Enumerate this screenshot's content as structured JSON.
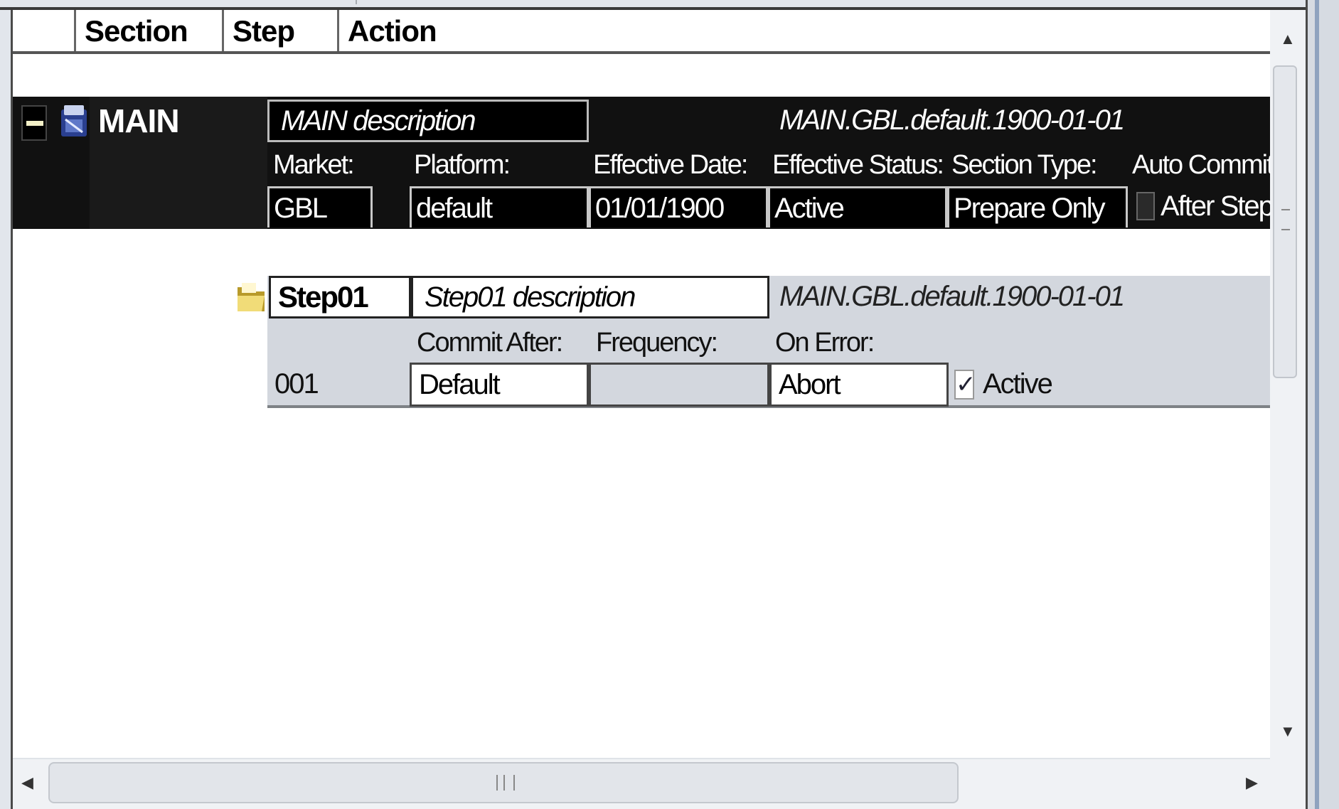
{
  "columns": {
    "section": "Section",
    "step": "Step",
    "action": "Action"
  },
  "section": {
    "name": "MAIN",
    "description": "MAIN description",
    "summary": "MAIN.GBL.default.1900-01-01",
    "labels": {
      "market": "Market:",
      "platform": "Platform:",
      "effective_date": "Effective Date:",
      "effective_status": "Effective Status:",
      "section_type": "Section Type:",
      "auto_commit": "Auto Commit:"
    },
    "values": {
      "market": "GBL",
      "platform": "default",
      "effective_date": "01/01/1900",
      "effective_status": "Active",
      "section_type": "Prepare Only"
    },
    "auto_commit_option": "After Step",
    "auto_commit_checked": false
  },
  "step": {
    "name": "Step01",
    "description": "Step01 description",
    "summary": "MAIN.GBL.default.1900-01-01",
    "number": "001",
    "labels": {
      "commit_after": "Commit After:",
      "frequency": "Frequency:",
      "on_error": "On Error:"
    },
    "values": {
      "commit_after": "Default",
      "frequency": "",
      "on_error": "Abort"
    },
    "active_label": "Active",
    "active_checked": true,
    "check_glyph": "✓"
  },
  "icons": {
    "collapse": "minus-box-icon",
    "section": "section-icon",
    "step": "folder-icon"
  },
  "colors": {
    "section_bg": "#111111",
    "step_bg": "#d3d7de",
    "frame": "#8fa3bf"
  }
}
